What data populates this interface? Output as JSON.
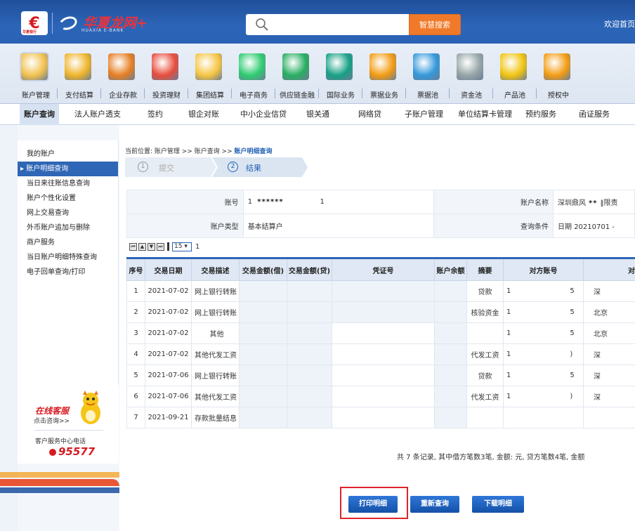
{
  "header": {
    "logo_small": "华夏银行",
    "brand": "华夏龙网+",
    "brand_sub": "HUAXIA E-BANK",
    "search_button": "智慧搜索",
    "search_placeholder": "",
    "welcome": "欢迎首页"
  },
  "nav": {
    "items": [
      {
        "label": "账户管理",
        "icon": "magnifier-coins-icon",
        "color": "#f2c14e"
      },
      {
        "label": "支付结算",
        "icon": "coin-stack-icon",
        "color": "#f0b429"
      },
      {
        "label": "企业存款",
        "icon": "money-bag-icon",
        "color": "#e67e22"
      },
      {
        "label": "投资理财",
        "icon": "growth-arrow-icon",
        "color": "#e74c3c"
      },
      {
        "label": "集团结算",
        "icon": "group-coins-icon",
        "color": "#f5c542"
      },
      {
        "label": "电子商务",
        "icon": "browser-e-icon",
        "color": "#2ecc71"
      },
      {
        "label": "供应链金融",
        "icon": "swap-icon",
        "color": "#27ae60"
      },
      {
        "label": "国际业务",
        "icon": "globe-doc-icon",
        "color": "#16a085"
      },
      {
        "label": "票据业务",
        "icon": "document-icon",
        "color": "#f39c12"
      },
      {
        "label": "票据池",
        "icon": "monitor-icon",
        "color": "#3498db"
      },
      {
        "label": "资金池",
        "icon": "faucet-icon",
        "color": "#95a5a6"
      },
      {
        "label": "产品池",
        "icon": "bowl-icon",
        "color": "#f1c40f"
      },
      {
        "label": "授权中",
        "icon": "lock-icon",
        "color": "#f39c12"
      }
    ]
  },
  "subnav": {
    "items": [
      "账户查询",
      "法人账户透支",
      "签约",
      "银企对账",
      "中小企业信贷",
      "银关通",
      "网络贷",
      "子账户管理",
      "单位结算卡管理",
      "预约服务",
      "函证服务"
    ]
  },
  "sidebar": {
    "items": [
      "我的账户",
      "账户明细查询",
      "当日来往账信息查询",
      "账户个性化设置",
      "网上交易查询",
      "外币账户追加与删除",
      "商户服务",
      "当日账户明细特殊查询",
      "电子回单查询/打印"
    ],
    "service_online": "在线客服",
    "service_consult": "点击咨询>>",
    "service_phone_label": "客户服务中心电话",
    "service_phone": "95577"
  },
  "breadcrumb": {
    "prefix": "当前位置: 账户管理 >> 账户查询 >>",
    "current": "账户明细查询"
  },
  "steps": [
    {
      "num": "1",
      "label": "提交"
    },
    {
      "num": "2",
      "label": "结果"
    }
  ],
  "info": {
    "account_label": "账号",
    "account_value_start": "1",
    "account_mask": "******",
    "account_value_end": "1",
    "name_label": "账户名称",
    "name_value_start": "深圳鼎风",
    "name_mask": "**",
    "name_value_end": "‖限责",
    "type_label": "账户类型",
    "type_value": "基本结算户",
    "cond_label": "查询条件",
    "cond_value": "日期 20210701 -"
  },
  "pager": {
    "page_size": "15",
    "page": "1"
  },
  "table": {
    "headers": [
      "序号",
      "交易日期",
      "交易描述",
      "交易金额(借)",
      "交易金额(贷)",
      "凭证号",
      "账户余额",
      "摘要",
      "对方账号",
      "对"
    ],
    "rows": [
      [
        "1",
        "2021-07-02",
        "网上银行转账",
        "",
        "",
        "",
        "",
        "贷款",
        "1",
        "5",
        "深"
      ],
      [
        "2",
        "2021-07-02",
        "网上银行转账",
        "",
        "",
        "",
        "",
        "核验资金",
        "1",
        "5",
        "北京"
      ],
      [
        "3",
        "2021-07-02",
        "其他",
        "",
        "",
        "",
        "",
        "",
        "1",
        "5",
        "北京"
      ],
      [
        "4",
        "2021-07-02",
        "其他代发工资",
        "",
        "",
        "",
        "",
        "代发工资",
        "1",
        ")",
        "深"
      ],
      [
        "5",
        "2021-07-06",
        "网上银行转账",
        "",
        "",
        "",
        "",
        "贷款",
        "1",
        "5",
        "深"
      ],
      [
        "6",
        "2021-07-06",
        "其他代发工资",
        "",
        "",
        "",
        "",
        "代发工资",
        "1",
        ")",
        "深"
      ],
      [
        "7",
        "2021-09-21",
        "存款批量结息",
        "",
        "",
        "",
        "",
        "",
        "",
        "",
        ""
      ]
    ]
  },
  "summary": "共 7 条记录, 其中借方笔数3笔, 金额:      元, 贷方笔数4笔, 金额",
  "buttons": {
    "print": "打印明细",
    "requery": "重新查询",
    "download": "下载明细"
  }
}
